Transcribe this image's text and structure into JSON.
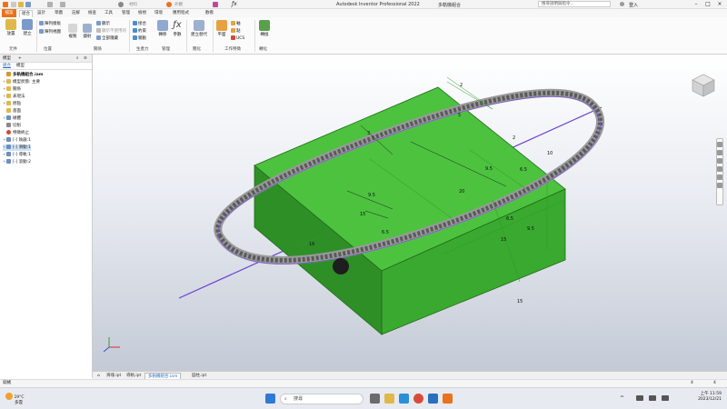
{
  "titlebar": {
    "app_title": "Autodesk Inventor Professional 2022",
    "doc_title": "多軌機組合",
    "material": "材料",
    "appearance": "外觀",
    "help_search": "搜尋說明與指令...",
    "signin": "登入"
  },
  "tabs": {
    "file": "檔案",
    "items": [
      "組合",
      "設計",
      "草圖",
      "註解",
      "檢查",
      "工具",
      "管理",
      "檢視",
      "環境",
      "應用程式",
      "歡看"
    ]
  },
  "ribbon": {
    "place": "放置",
    "create": "建立",
    "component_group": "元件",
    "pattern1": "陣列樣板",
    "pattern2": "陣列視圖",
    "copy": "複製",
    "mirror": "鏡射",
    "show": "顯示",
    "show_unused": "顯示不使用的",
    "hide_all": "全部隱藏",
    "place_group": "位置",
    "relation_group": "關係",
    "joint": "接合",
    "constrain": "約束",
    "drive": "驅動",
    "measure": "轉移",
    "productivity": "生產力",
    "params": "參數",
    "params_group": "管理",
    "create_substitute": "建立替代",
    "simplify_group": "簡化",
    "plane": "平面",
    "axis": "軸",
    "point": "點",
    "ucs": "UCS",
    "work_features_group": "工作特徵",
    "convert": "轉換",
    "convert_group": "轉化"
  },
  "browser": {
    "tab_model": "模型",
    "tab_add": "+",
    "sub_tab1": "組合",
    "sub_tab2": "模型",
    "nodes": [
      {
        "label": "多軌機組合.iam",
        "icon": "assembly-icon",
        "color": "#d19a2a"
      },
      {
        "label": "模型狀態: 主要",
        "icon": "folder-icon",
        "color": "#e0b84a"
      },
      {
        "label": "關係",
        "icon": "folder-icon",
        "color": "#e0b84a"
      },
      {
        "label": "表現法",
        "icon": "folder-icon",
        "color": "#e0b84a"
      },
      {
        "label": "原點",
        "icon": "folder-icon",
        "color": "#e0b84a"
      },
      {
        "label": "基面",
        "icon": "folder-icon",
        "color": "#e0b84a"
      },
      {
        "label": "磁體",
        "icon": "part-icon",
        "color": "#6a8fbf"
      },
      {
        "label": "切削",
        "icon": "feature-icon",
        "color": "#8a8a8a"
      },
      {
        "label": "特徵終止",
        "icon": "stop-icon",
        "color": "#d04a3a"
      },
      {
        "label": "[-] 執器:1",
        "icon": "part-icon",
        "color": "#6a8fbf"
      },
      {
        "label": "[-] 滑動:1",
        "icon": "part-icon",
        "color": "#6a8fbf"
      },
      {
        "label": "[-] 導軌:1",
        "icon": "part-icon",
        "color": "#6a8fbf"
      },
      {
        "label": "[-] 滾動:2",
        "icon": "part-icon",
        "color": "#6a8fbf"
      }
    ]
  },
  "dimensions": {
    "d1": "2",
    "d2": "5",
    "d3": "3",
    "d4": "2",
    "d5": "10",
    "d6": "9.5",
    "d7": "9.5",
    "d8": "20",
    "d9": "15",
    "d10": "6.5",
    "d11": "6.5",
    "d12": "9.5",
    "d13": "15",
    "d14": "16",
    "d15": "15",
    "d16": "6.5"
  },
  "doctabs": [
    {
      "label": "滑塊.ipt",
      "active": false
    },
    {
      "label": "導軌.ipt",
      "active": false
    },
    {
      "label": "多軌機組合.iam",
      "active": true
    },
    {
      "label": "圓柱.ipt",
      "active": false
    }
  ],
  "status": {
    "left": "就緒",
    "count1": "4",
    "count2": "4"
  },
  "taskbar": {
    "weather_temp": "19°C",
    "weather_desc": "多雲",
    "search": "搜尋",
    "time": "上午 11:59",
    "date": "2023/12/21"
  },
  "colors": {
    "accent": "#e8731c",
    "block": "#3fae34",
    "block_dark": "#2f8a27"
  }
}
